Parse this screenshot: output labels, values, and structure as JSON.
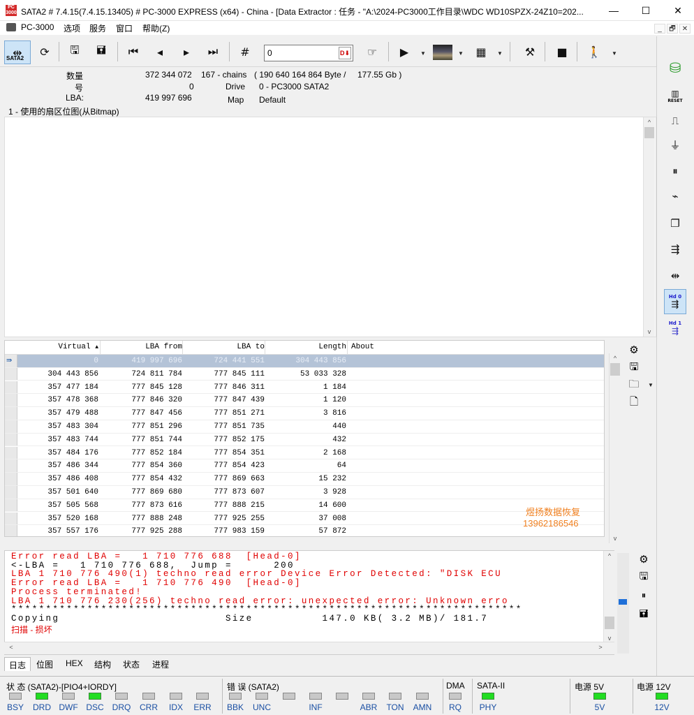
{
  "window": {
    "title": "SATA2 # 7.4.15(7.4.15.13405) # PC-3000 EXPRESS (x64) - China - [Data Extractor : 任务 - \"A:\\2024-PC3000工作目录\\WDC WD10SPZX-24Z10=202...",
    "icon_text": "PC\n3000",
    "minimize": "—",
    "maximize": "☐",
    "close": "✕"
  },
  "menu": {
    "items": [
      "PC-3000",
      "选项",
      "服务",
      "窗口",
      "帮助(Z)"
    ],
    "mdi_min": "_",
    "mdi_restore": "🗗",
    "mdi_close": "✕"
  },
  "toolbar": {
    "sata_label": "SATA2",
    "lba_value": "0",
    "lba_btn": "D⬇",
    "icons": [
      "sata-port-icon",
      "refresh-icon",
      "save-icon",
      "save-as-icon",
      "first-icon",
      "prev-icon",
      "next-icon",
      "last-icon",
      "hash-icon",
      "goto-icon",
      "play-icon",
      "image-icon",
      "grid-icon",
      "tools-icon",
      "stop-icon",
      "exit-icon"
    ]
  },
  "info": {
    "count_label": "数量",
    "count_value": "372 344 072",
    "chains": "167 - chains",
    "bytes": "( 190 640 164 864 Byte /",
    "gb": "177.55 Gb )",
    "num_label": "号",
    "num_value": "0",
    "drive_label": "Drive",
    "drive_value": "0 - PC3000 SATA2",
    "lba_label": "LBA:",
    "lba_value": "419 997 696",
    "map_label": "Map",
    "map_value": "Default"
  },
  "bitmap": {
    "title": "1 - 使用的扇区位图(从Bitmap)"
  },
  "table": {
    "columns": [
      "Virtual",
      "LBA from",
      "LBA to",
      "Length",
      "About"
    ],
    "sort_indicator": "▲",
    "rows": [
      [
        "0",
        "419 997 696",
        "724 441 551",
        "304 443 856",
        ""
      ],
      [
        "304 443 856",
        "724 811 784",
        "777 845 111",
        "53 033 328",
        ""
      ],
      [
        "357 477 184",
        "777 845 128",
        "777 846 311",
        "1 184",
        ""
      ],
      [
        "357 478 368",
        "777 846 320",
        "777 847 439",
        "1 120",
        ""
      ],
      [
        "357 479 488",
        "777 847 456",
        "777 851 271",
        "3 816",
        ""
      ],
      [
        "357 483 304",
        "777 851 296",
        "777 851 735",
        "440",
        ""
      ],
      [
        "357 483 744",
        "777 851 744",
        "777 852 175",
        "432",
        ""
      ],
      [
        "357 484 176",
        "777 852 184",
        "777 854 351",
        "2 168",
        ""
      ],
      [
        "357 486 344",
        "777 854 360",
        "777 854 423",
        "64",
        ""
      ],
      [
        "357 486 408",
        "777 854 432",
        "777 869 663",
        "15 232",
        ""
      ],
      [
        "357 501 640",
        "777 869 680",
        "777 873 607",
        "3 928",
        ""
      ],
      [
        "357 505 568",
        "777 873 616",
        "777 888 215",
        "14 600",
        ""
      ],
      [
        "357 520 168",
        "777 888 248",
        "777 925 255",
        "37 008",
        ""
      ],
      [
        "357 557 176",
        "777 925 288",
        "777 983 159",
        "57 872",
        ""
      ]
    ],
    "watermark_name": "煜扬数据恢复",
    "watermark_phone": "13962186546"
  },
  "log": {
    "lines": [
      {
        "text": "Error read LBA =   1 710 776 688  [Head-0]",
        "color": "red"
      },
      {
        "text": "<-LBA =   1 710 776 688,  Jump =      200",
        "color": "black"
      },
      {
        "text": "LBA 1 710 776 490(1) techno read error Device Error Detected: \"DISK ECU",
        "color": "red"
      },
      {
        "text": "Error read LBA =   1 710 776 490  [Head-0]",
        "color": "red"
      },
      {
        "text": "Process terminated!",
        "color": "red"
      },
      {
        "text": "LBA 1 710 776 230(256) techno read error: unexpected error: Unknown erro",
        "color": "red"
      },
      {
        "text": "**************************************************************************",
        "color": "black"
      },
      {
        "text": "Copying                        Size          147.0 KB( 3.2 MB)/ 181.7",
        "color": "black"
      }
    ],
    "last_line": "扫描 - 损坏"
  },
  "tabs": [
    "日志",
    "位图",
    "HEX",
    "结构",
    "状态",
    "进程"
  ],
  "status": {
    "state_title": "状 态 (SATA2)-[PIO4+IORDY]",
    "error_title": "错 误 (SATA2)",
    "dma_title": "DMA",
    "sata_title": "SATA-II",
    "power5_title": "电源 5V",
    "power12_title": "电源 12V",
    "state_leds": [
      {
        "label": "BSY",
        "on": false
      },
      {
        "label": "DRD",
        "on": true
      },
      {
        "label": "DWF",
        "on": false
      },
      {
        "label": "DSC",
        "on": true
      },
      {
        "label": "DRQ",
        "on": false
      },
      {
        "label": "CRR",
        "on": false
      },
      {
        "label": "IDX",
        "on": false
      },
      {
        "label": "ERR",
        "on": false
      }
    ],
    "error_leds": [
      {
        "label": "BBK",
        "on": false
      },
      {
        "label": "UNC",
        "on": false
      },
      {
        "label": "",
        "on": false
      },
      {
        "label": "INF",
        "on": false
      },
      {
        "label": "",
        "on": false
      },
      {
        "label": "ABR",
        "on": false
      },
      {
        "label": "TON",
        "on": false
      },
      {
        "label": "AMN",
        "on": false
      }
    ],
    "dma_led": {
      "label": "RQ",
      "on": false
    },
    "sata_led": {
      "label": "PHY",
      "on": true
    },
    "power5_led": {
      "label": "5V",
      "on": true
    },
    "power12_led": {
      "label": "12V",
      "on": true
    }
  },
  "rightbar": {
    "hd0": "Hd 0",
    "hd1": "Hd 1",
    "reset": "RESET"
  },
  "colors": {
    "selected_row": "#b4c3d7",
    "log_red": "#e00000",
    "led_on": "#22dd22",
    "accent_selected": "#cde4f7"
  }
}
